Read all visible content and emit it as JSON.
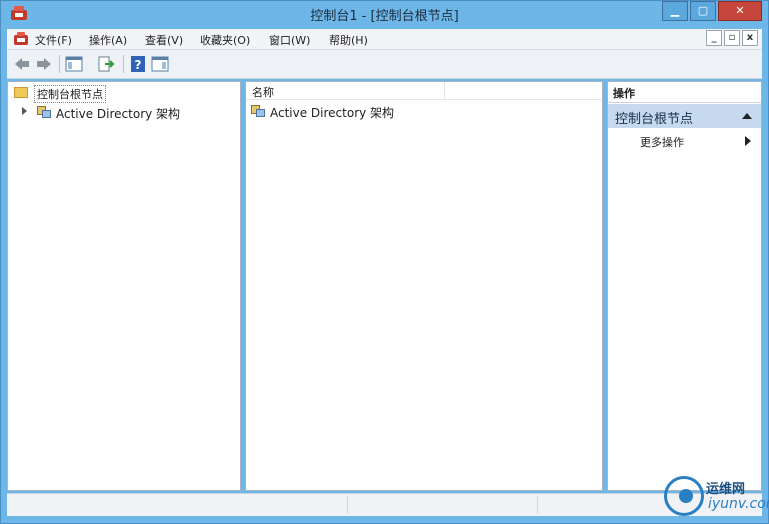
{
  "window": {
    "title": "控制台1 - [控制台根节点]",
    "minimize_glyph": "▁",
    "maximize_glyph": "▢",
    "close_glyph": "✕"
  },
  "menu": {
    "items": [
      "文件(F)",
      "操作(A)",
      "查看(V)",
      "收藏夹(O)",
      "窗口(W)",
      "帮助(H)"
    ],
    "mdi_buttons": [
      "_",
      "▫",
      "x"
    ]
  },
  "toolbar": {
    "icons": [
      "back-arrow-icon",
      "forward-arrow-icon",
      "show-hide-console-tree-icon",
      "export-list-icon",
      "help-icon",
      "show-hide-action-pane-icon"
    ]
  },
  "tree": {
    "root_label": "控制台根节点",
    "child_label": "Active Directory 架构"
  },
  "list": {
    "column_header": "名称",
    "rows": [
      "Active Directory 架构"
    ]
  },
  "actions": {
    "title": "操作",
    "section": "控制台根节点",
    "items": [
      "更多操作"
    ]
  },
  "watermark": {
    "text_cn": "运维网",
    "text_en": "iyunv.com"
  },
  "colors": {
    "window_frame": "#6db6e8",
    "action_section_bg": "#c7d9ee",
    "close_button": "#c7463c"
  }
}
